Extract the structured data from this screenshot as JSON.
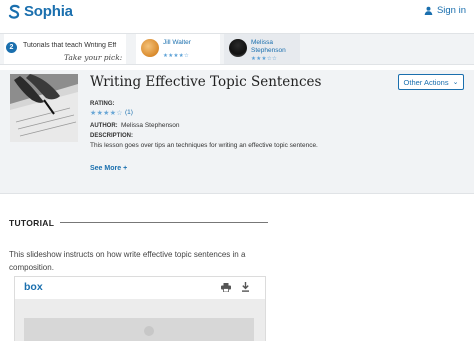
{
  "header": {
    "logo_text": "Sophia",
    "signin_label": "Sign in"
  },
  "teachers_strip": {
    "count": "2",
    "text": "Tutorials that teach Writing Eff",
    "pick_label": "Take your pick:",
    "teachers": [
      {
        "name": "Jill Walter",
        "rating_stars": "★★★★☆"
      },
      {
        "name_line1": "Melissa",
        "name_line2": "Stephenson",
        "rating_stars": "★★★☆☆"
      }
    ]
  },
  "lesson": {
    "title": "Writing Effective Topic Sentences",
    "other_actions_label": "Other Actions",
    "rating_label": "RATING:",
    "rating_stars": "★★★★☆",
    "rating_count": "(1)",
    "author_label": "AUTHOR:",
    "author_name": "Melissa Stephenson",
    "description_label": "DESCRIPTION:",
    "description": "This lesson goes over tips an techniques for writing an effective topic sentence.",
    "see_more_label": "See More +"
  },
  "tutorial": {
    "heading": "TUTORIAL",
    "description": "This slideshow instructs on how write effective topic sentences in a composition."
  },
  "embed": {
    "logo_text": "box"
  },
  "colors": {
    "brand_blue": "#1a6fae",
    "panel_bg": "#f1f3f5",
    "star_blue": "#6aa7d6"
  },
  "icons": [
    "sophia-logo-icon",
    "person-icon",
    "print-icon",
    "download-icon",
    "chevron-down-icon"
  ]
}
